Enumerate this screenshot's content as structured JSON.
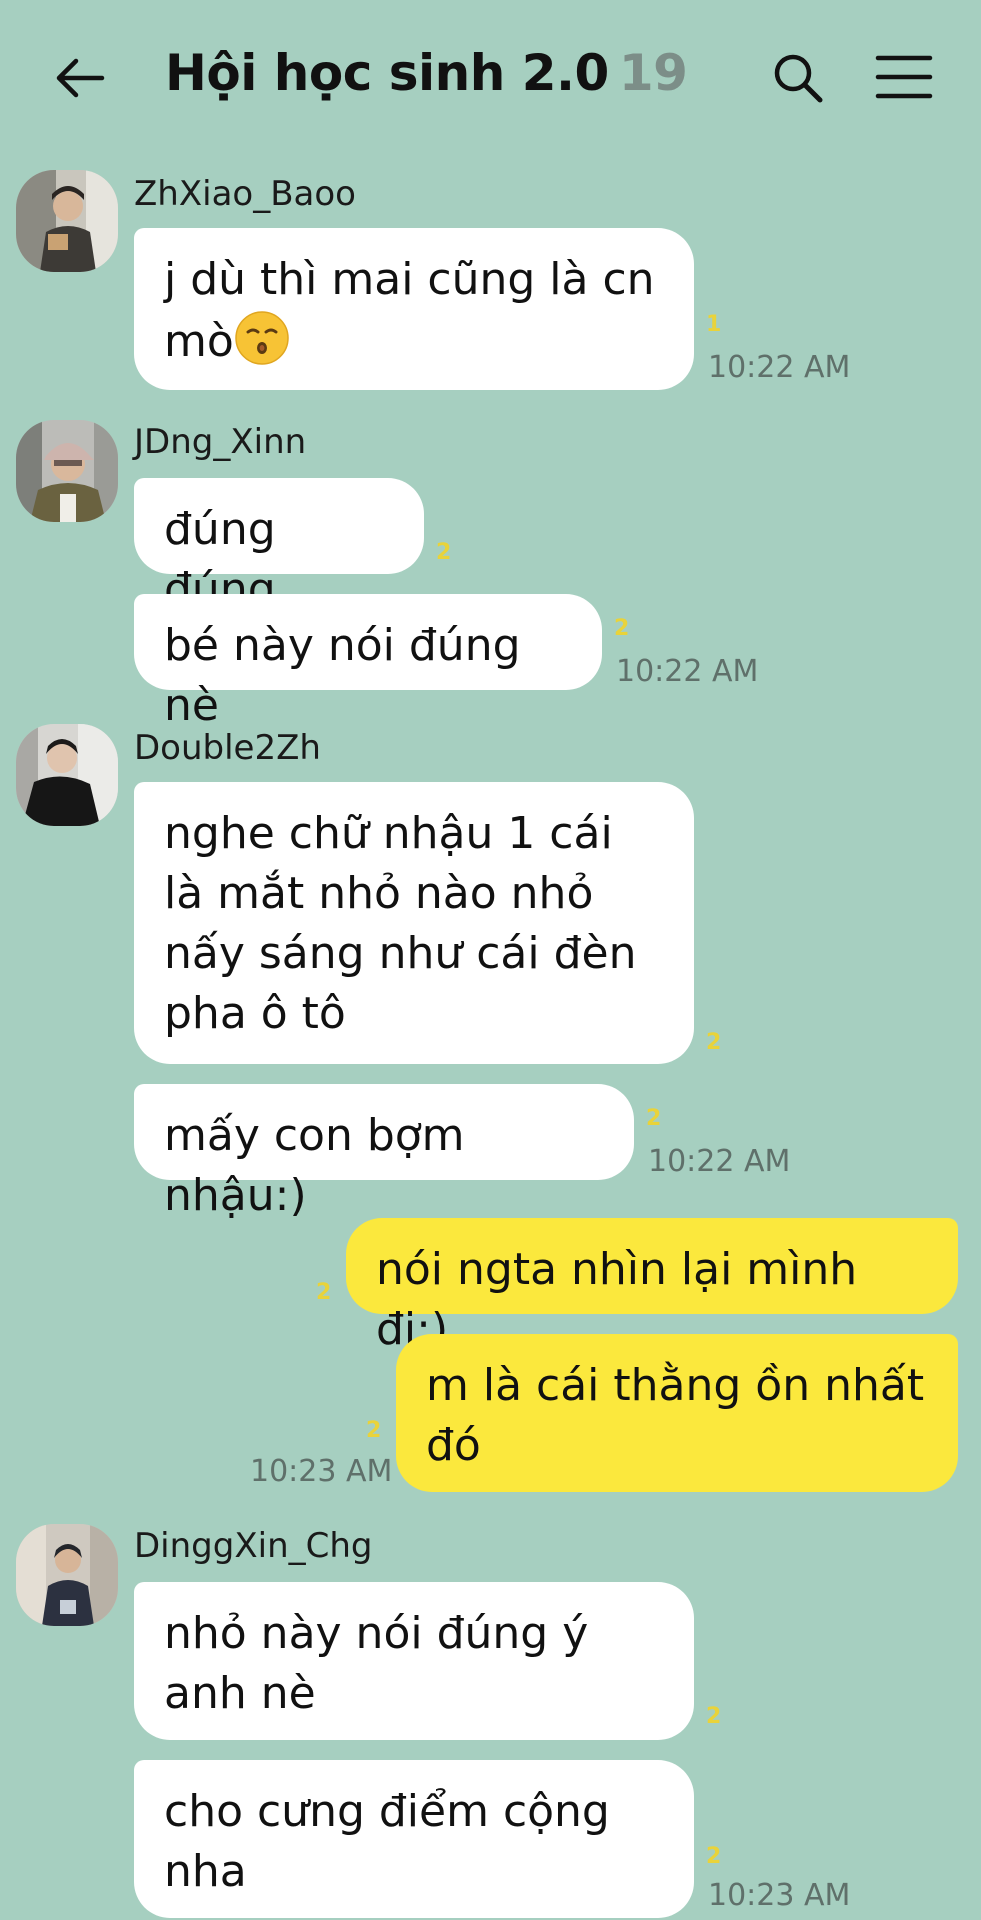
{
  "header": {
    "title": "Hội học sinh 2.0",
    "member_count": "19"
  },
  "messages": [
    {
      "sender": "ZhXiao_Baoo",
      "text": "j dù thì mai cũng là cn mò",
      "emoji": "kissing-face",
      "unread": "1",
      "time": "10:22 AM"
    },
    {
      "sender": "JDng_Xinn",
      "text": "đúng đúng",
      "unread": "2"
    },
    {
      "text": "bé này nói đúng nè",
      "unread": "2",
      "time": "10:22 AM"
    },
    {
      "sender": "Double2Zh",
      "text": "nghe chữ nhậu 1 cái là mắt nhỏ nào nhỏ nấy sáng như cái đèn pha ô tô",
      "unread": "2"
    },
    {
      "text": "mấy con bợm nhậu:)",
      "unread": "2",
      "time": "10:22 AM"
    },
    {
      "mine": true,
      "text": "nói ngta nhìn lại mình đi:)",
      "unread": "2"
    },
    {
      "mine": true,
      "text": "m là cái thằng ồn nhất đó",
      "unread": "2",
      "time": "10:23 AM"
    },
    {
      "sender": "DinggXin_Chg",
      "text": "nhỏ này nói đúng ý anh nè",
      "unread": "2"
    },
    {
      "text": "cho cưng điểm cộng nha",
      "unread": "2",
      "time": "10:23 AM"
    }
  ],
  "colors": {
    "background": "#a6cfc0",
    "incoming_bubble": "#ffffff",
    "outgoing_bubble": "#fbe83d",
    "unread_count": "#e9d33a",
    "timestamp": "#5f706a"
  },
  "icons": [
    "back-arrow-icon",
    "search-icon",
    "menu-icon",
    "kissing-face-emoji"
  ]
}
